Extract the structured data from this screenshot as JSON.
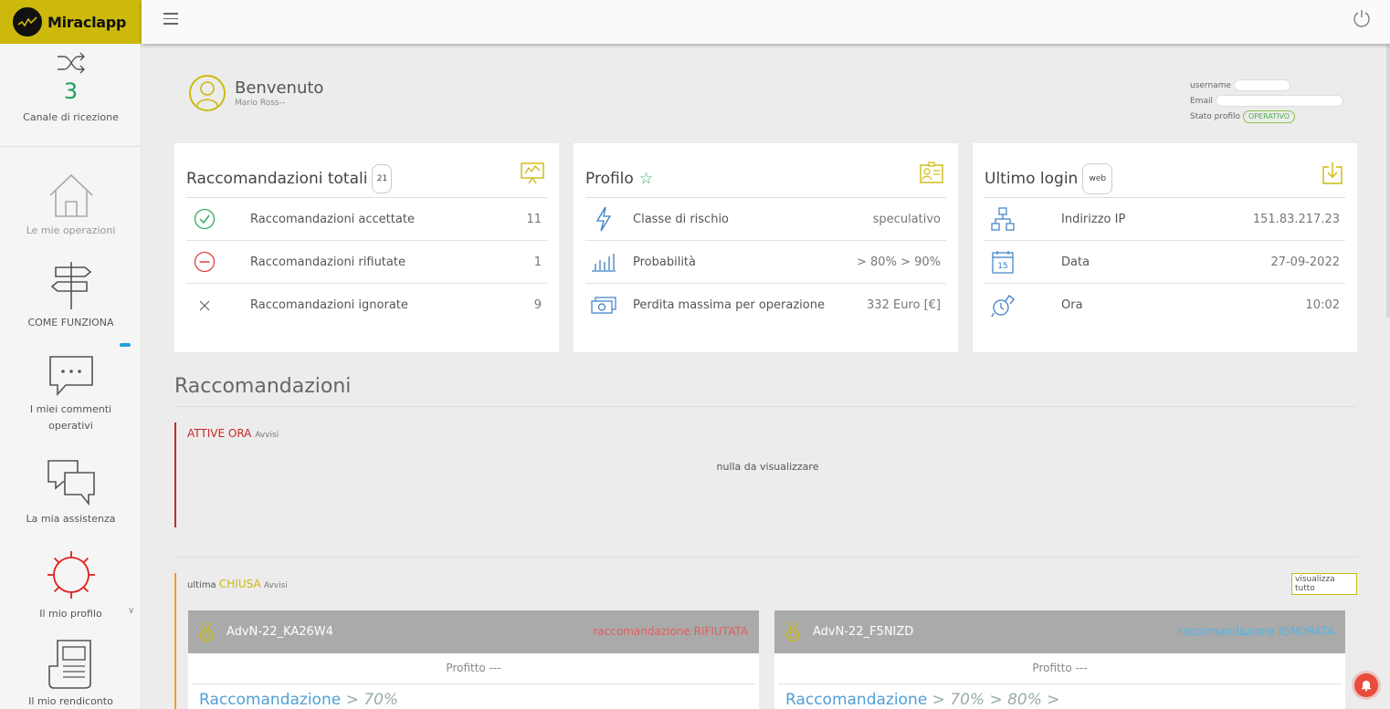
{
  "brand": {
    "name": "Miraclapp",
    "color": "#ccb90c"
  },
  "sidebar": {
    "channel_count": "3",
    "channel_label": "Canale di ricezione",
    "items": [
      {
        "label": "Le mie operazioni",
        "icon": "house-icon"
      },
      {
        "label": "COME FUNZIONA",
        "icon": "signpost-icon"
      },
      {
        "label": "I miei commenti operativi",
        "icon": "chat-bubble-icon"
      },
      {
        "label": "La mia assistenza",
        "icon": "chat-bubbles-icon"
      },
      {
        "label": "Il mio profilo",
        "icon": "gear-icon"
      },
      {
        "label": "Il mio rendiconto",
        "icon": "document-icon"
      }
    ]
  },
  "welcome": {
    "title": "Benvenuto",
    "name": "Mario Ross--"
  },
  "userinfo": {
    "username_label": "username",
    "email_label": "Email",
    "status_label": "Stato profilo",
    "status_value": "OPERATIVO"
  },
  "cards": {
    "recommendations": {
      "title": "Raccomandazioni totali",
      "total": "21",
      "rows": [
        {
          "label": "Raccomandazioni accettate",
          "value": "11"
        },
        {
          "label": "Raccomandazioni rifiutate",
          "value": "1"
        },
        {
          "label": "Raccomandazioni ignorate",
          "value": "9"
        }
      ]
    },
    "profile": {
      "title": "Profilo",
      "rows": [
        {
          "label": "Classe di rischio",
          "value": "speculativo"
        },
        {
          "label": "Probabilità",
          "value": "> 80% > 90%"
        },
        {
          "label": "Perdita massima per operazione",
          "value": "332 Euro [€]"
        }
      ]
    },
    "login": {
      "title": "Ultimo login",
      "badge": "web",
      "calendar_day": "15",
      "rows": [
        {
          "label": "Indirizzo IP",
          "value": "151.83.217.23"
        },
        {
          "label": "Data",
          "value": "27-09-2022"
        },
        {
          "label": "Ora",
          "value": "10:02"
        }
      ]
    }
  },
  "section": {
    "title": "Raccomandazioni",
    "active": {
      "label": "ATTIVE ORA",
      "small": "Avvisi",
      "empty": "nulla da visualizzare"
    },
    "closed": {
      "prefix": "ultima",
      "label": "CHIUSA",
      "small": "Avvisi",
      "view_all": "visualizza tutto",
      "items": [
        {
          "code": "AdvN-22_KA26W4",
          "status": "raccomandazione RIFIUTATA",
          "profit": "Profitto ---",
          "rec_label": "Raccomandazione",
          "rec_value": "> 70%"
        },
        {
          "code": "AdvN-22_F5NIZD",
          "status": "raccomandazione IGNORATA",
          "profit": "Profitto ---",
          "rec_label": "Raccomandazione",
          "rec_value": "> 70% > 80% >"
        }
      ]
    }
  }
}
